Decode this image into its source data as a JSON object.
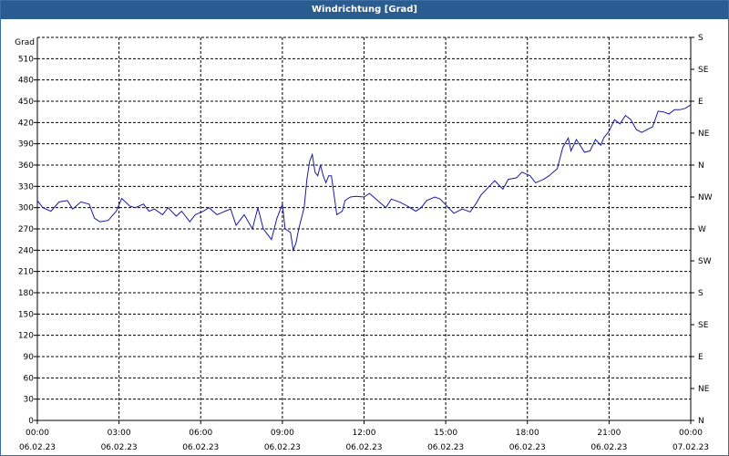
{
  "window": {
    "title": "Windrichtung [Grad]"
  },
  "colors": {
    "titlebar": "#2a5c8f",
    "line": "#1a1aa0",
    "grid": "#000000"
  },
  "chart_data": {
    "type": "line",
    "title": "Windrichtung [Grad]",
    "ylabel": "Grad",
    "ylim": [
      0,
      540
    ],
    "yticks": [
      0,
      30,
      60,
      90,
      120,
      150,
      180,
      210,
      240,
      270,
      300,
      330,
      360,
      390,
      420,
      450,
      480,
      510
    ],
    "y2ticks": [
      {
        "value": 0,
        "label": "N"
      },
      {
        "value": 45,
        "label": "NE"
      },
      {
        "value": 90,
        "label": "E"
      },
      {
        "value": 135,
        "label": "SE"
      },
      {
        "value": 180,
        "label": "S"
      },
      {
        "value": 225,
        "label": "SW"
      },
      {
        "value": 270,
        "label": "W"
      },
      {
        "value": 315,
        "label": "NW"
      },
      {
        "value": 360,
        "label": "N"
      },
      {
        "value": 405,
        "label": "NE"
      },
      {
        "value": 450,
        "label": "E"
      },
      {
        "value": 495,
        "label": "SE"
      },
      {
        "value": 540,
        "label": "S"
      }
    ],
    "xlim": [
      0,
      24
    ],
    "xticks": [
      {
        "hour": 0,
        "time": "00:00",
        "date": "06.02.23"
      },
      {
        "hour": 3,
        "time": "03:00",
        "date": "06.02.23"
      },
      {
        "hour": 6,
        "time": "06:00",
        "date": "06.02.23"
      },
      {
        "hour": 9,
        "time": "09:00",
        "date": "06.02.23"
      },
      {
        "hour": 12,
        "time": "12:00",
        "date": "06.02.23"
      },
      {
        "hour": 15,
        "time": "15:00",
        "date": "06.02.23"
      },
      {
        "hour": 18,
        "time": "18:00",
        "date": "06.02.23"
      },
      {
        "hour": 21,
        "time": "21:00",
        "date": "06.02.23"
      },
      {
        "hour": 24,
        "time": "00:00",
        "date": "07.02.23"
      }
    ],
    "grid": true,
    "series": [
      {
        "x": [
          0.0,
          0.2,
          0.5,
          0.8,
          1.1,
          1.3,
          1.6,
          1.9,
          2.1,
          2.3,
          2.6,
          2.9,
          3.1,
          3.4,
          3.6,
          3.9,
          4.1,
          4.3,
          4.6,
          4.8,
          5.1,
          5.3,
          5.6,
          5.8,
          6.1,
          6.3,
          6.6,
          6.9,
          7.1,
          7.3,
          7.6,
          7.9,
          8.1,
          8.3,
          8.6,
          8.8,
          9.0,
          9.1,
          9.3,
          9.4,
          9.5,
          9.6,
          9.8,
          9.9,
          10.0,
          10.1,
          10.2,
          10.3,
          10.4,
          10.5,
          10.6,
          10.7,
          10.8,
          11.0,
          11.2,
          11.3,
          11.5,
          11.7,
          12.0,
          12.2,
          12.5,
          12.8,
          13.0,
          13.3,
          13.6,
          13.9,
          14.1,
          14.3,
          14.6,
          14.8,
          15.1,
          15.3,
          15.6,
          15.9,
          16.1,
          16.3,
          16.6,
          16.8,
          17.1,
          17.3,
          17.6,
          17.8,
          18.1,
          18.3,
          18.6,
          18.8,
          19.1,
          19.3,
          19.5,
          19.6,
          19.8,
          20.0,
          20.1,
          20.3,
          20.5,
          20.7,
          20.8,
          21.0,
          21.2,
          21.4,
          21.6,
          21.8,
          22.0,
          22.2,
          22.4,
          22.6,
          22.8,
          23.0,
          23.2,
          23.4,
          23.6,
          23.8,
          24.0
        ],
        "values": [
          310,
          300,
          295,
          308,
          310,
          298,
          308,
          305,
          285,
          280,
          282,
          295,
          313,
          302,
          300,
          305,
          295,
          298,
          290,
          300,
          288,
          295,
          280,
          290,
          295,
          300,
          290,
          295,
          298,
          275,
          290,
          270,
          300,
          270,
          255,
          285,
          305,
          270,
          265,
          240,
          250,
          270,
          300,
          340,
          365,
          375,
          350,
          345,
          360,
          345,
          335,
          345,
          345,
          290,
          295,
          310,
          315,
          316,
          315,
          320,
          310,
          300,
          312,
          308,
          302,
          295,
          300,
          310,
          315,
          312,
          300,
          292,
          298,
          294,
          305,
          318,
          330,
          338,
          326,
          340,
          342,
          350,
          345,
          335,
          340,
          345,
          355,
          385,
          398,
          380,
          396,
          384,
          378,
          380,
          396,
          388,
          398,
          408,
          424,
          418,
          430,
          424,
          410,
          406,
          410,
          414,
          436,
          435,
          432,
          438,
          438,
          440,
          445
        ]
      }
    ]
  }
}
